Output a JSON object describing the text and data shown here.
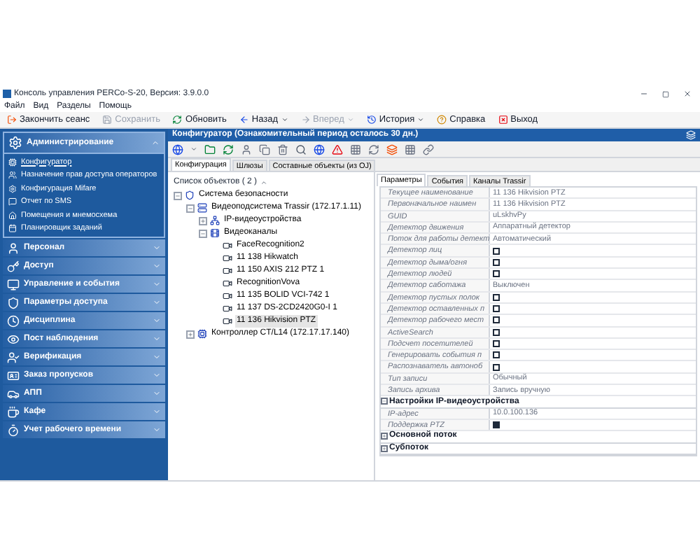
{
  "window": {
    "title": "Консоль управления PERCo-S-20, Версия: 3.9.0.0"
  },
  "menu": [
    "Файл",
    "Вид",
    "Разделы",
    "Помощь"
  ],
  "toolbar": [
    {
      "label": "Закончить сеанс",
      "disabled": false,
      "dropdown": false
    },
    {
      "label": "Сохранить",
      "disabled": true,
      "dropdown": false
    },
    {
      "label": "Обновить",
      "disabled": false,
      "dropdown": false
    },
    {
      "label": "Назад",
      "disabled": false,
      "dropdown": true
    },
    {
      "label": "Вперед",
      "disabled": true,
      "dropdown": true
    },
    {
      "label": "История",
      "disabled": false,
      "dropdown": true
    },
    {
      "label": "Справка",
      "disabled": false,
      "dropdown": false
    },
    {
      "label": "Выход",
      "disabled": false,
      "dropdown": false
    }
  ],
  "sidebar": {
    "sections": [
      {
        "label": "Администрирование",
        "expanded": true,
        "items": [
          {
            "label": "Конфигуратор",
            "selected": true
          },
          {
            "label": "Назначение прав доступа операторов",
            "selected": false
          },
          {
            "label": "Конфигурация Mifare",
            "selected": false
          },
          {
            "label": "Отчет по SMS",
            "selected": false
          },
          {
            "label": "Помещения и мнемосхема",
            "selected": false
          },
          {
            "label": "Планировщик заданий",
            "selected": false
          }
        ]
      },
      {
        "label": "Персонал",
        "expanded": false
      },
      {
        "label": "Доступ",
        "expanded": false
      },
      {
        "label": "Управление и события",
        "expanded": false
      },
      {
        "label": "Параметры доступа",
        "expanded": false
      },
      {
        "label": "Дисциплина",
        "expanded": false
      },
      {
        "label": "Пост наблюдения",
        "expanded": false
      },
      {
        "label": "Верификация",
        "expanded": false
      },
      {
        "label": "Заказ пропусков",
        "expanded": false
      },
      {
        "label": "АПП",
        "expanded": false
      },
      {
        "label": "Кафе",
        "expanded": false
      },
      {
        "label": "Учет рабочего времени",
        "expanded": false
      }
    ]
  },
  "configurator": {
    "title": "Конфигуратор (Ознакомительный период осталось 30 дн.)",
    "tabs": [
      {
        "label": "Конфигурация",
        "selected": true
      },
      {
        "label": "Шлюзы",
        "selected": false
      },
      {
        "label": "Составные объекты (из OJ)",
        "selected": false
      }
    ],
    "tree": {
      "header": "Список объектов ( 2 )",
      "nodes": [
        {
          "label": "Система безопасности",
          "expanded": true,
          "selected": false,
          "children": [
            {
              "label": "Видеоподсистема Trassir (172.17.1.11)",
              "expanded": true,
              "selected": false,
              "children": [
                {
                  "label": "IP-видеоустройства",
                  "expanded": false,
                  "selected": false
                },
                {
                  "label": "Видеоканалы",
                  "expanded": true,
                  "selected": false,
                  "children": [
                    {
                      "label": "FaceRecognition2",
                      "selected": false
                    },
                    {
                      "label": "11 138 Hikwatch",
                      "selected": false
                    },
                    {
                      "label": "11 150 AXIS 212 PTZ 1",
                      "selected": false
                    },
                    {
                      "label": "RecognitionVova",
                      "selected": false
                    },
                    {
                      "label": "11 135 BOLID VCI-742 1",
                      "selected": false
                    },
                    {
                      "label": "11 137 DS-2CD2420G0-I 1",
                      "selected": false
                    },
                    {
                      "label": "11 136 Hikvision PTZ",
                      "selected": true
                    }
                  ]
                }
              ]
            },
            {
              "label": "Контроллер CT/L14 (172.17.17.140)",
              "expanded": false,
              "selected": false
            }
          ]
        }
      ]
    },
    "property_tabs": [
      {
        "label": "Параметры",
        "selected": true
      },
      {
        "label": "События",
        "selected": false
      },
      {
        "label": "Каналы Trassir",
        "selected": false
      }
    ],
    "properties": [
      {
        "kind": "text",
        "label": "Текущее наименование",
        "value": "11 136 Hikvision PTZ"
      },
      {
        "kind": "text",
        "label": "Первоначальное наимен",
        "value": "11 136 Hikvision PTZ"
      },
      {
        "kind": "text",
        "label": "GUID",
        "value": "uLskhvPy"
      },
      {
        "kind": "text",
        "label": "Детектор движения",
        "value": "Аппаратный детектор"
      },
      {
        "kind": "text",
        "label": "Поток для работы детект",
        "value": "Автоматический"
      },
      {
        "kind": "checkbox",
        "label": "Детектор лиц",
        "checked": false
      },
      {
        "kind": "checkbox",
        "label": "Детектор дыма/огня",
        "checked": false
      },
      {
        "kind": "checkbox",
        "label": "Детектор людей",
        "checked": false
      },
      {
        "kind": "text",
        "label": "Детектор саботажа",
        "value": "Выключен"
      },
      {
        "kind": "checkbox",
        "label": "Детектор пустых полок",
        "checked": false
      },
      {
        "kind": "checkbox",
        "label": "Детектор оставленных п",
        "checked": false
      },
      {
        "kind": "checkbox",
        "label": "Детектор рабочего мест",
        "checked": false
      },
      {
        "kind": "checkbox",
        "label": "ActiveSearch",
        "checked": false
      },
      {
        "kind": "checkbox",
        "label": "Подсчет посетителей",
        "checked": false
      },
      {
        "kind": "checkbox",
        "label": "Генерировать события п",
        "checked": false
      },
      {
        "kind": "checkbox",
        "label": "Распознаватель автоноб",
        "checked": false
      },
      {
        "kind": "text",
        "label": "Тип записи",
        "value": "Обычный"
      },
      {
        "kind": "text",
        "label": "Запись архива",
        "value": "Запись вручную"
      },
      {
        "kind": "group",
        "label": "Настройки IP-видеоустройства",
        "expanded": true
      },
      {
        "kind": "text",
        "label": "IP-адрес",
        "value": "10.0.100.136"
      },
      {
        "kind": "checkbox",
        "label": "Поддержка PTZ",
        "checked": true
      },
      {
        "kind": "group",
        "label": "Основной поток",
        "expanded": false
      },
      {
        "kind": "group",
        "label": "Субпоток",
        "expanded": false
      }
    ]
  }
}
